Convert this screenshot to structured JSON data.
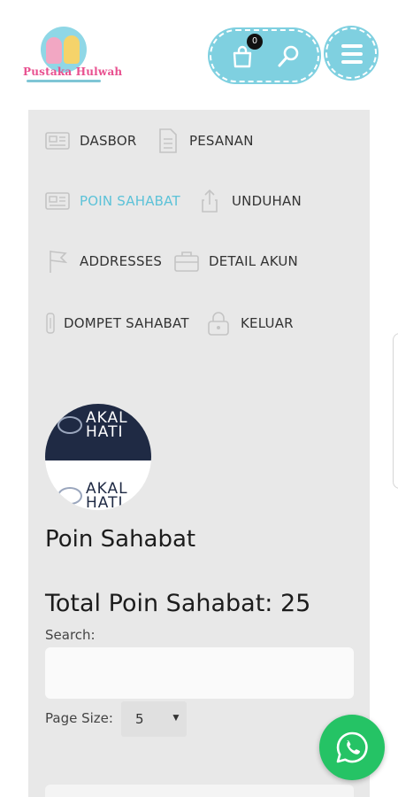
{
  "header": {
    "logo_text": "Pustaka Hulwah",
    "cart_count": "0"
  },
  "nav": [
    {
      "label": "DASBOR",
      "icon": "dashboard-icon",
      "active": false
    },
    {
      "label": "PESANAN",
      "icon": "document-icon",
      "active": false
    },
    {
      "label": "POIN SAHABAT",
      "icon": "points-icon",
      "active": true
    },
    {
      "label": "UNDUHAN",
      "icon": "download-icon",
      "active": false
    },
    {
      "label": "ADDRESSES",
      "icon": "flag-icon",
      "active": false
    },
    {
      "label": "DETAIL AKUN",
      "icon": "briefcase-icon",
      "active": false
    },
    {
      "label": "DOMPET SAHABAT",
      "icon": "wallet-icon",
      "active": false
    },
    {
      "label": "KELUAR",
      "icon": "lock-icon",
      "active": false
    }
  ],
  "avatar": {
    "line1": "AKAL",
    "line2": "HATI"
  },
  "main": {
    "title": "Poin Sahabat",
    "total": "Total Poin Sahabat: 25",
    "search_label": "Search:",
    "search_value": "",
    "page_size_label": "Page Size:",
    "page_size_value": "5"
  },
  "colors": {
    "accent": "#7fd0e0",
    "active_link": "#5cc2d8",
    "panel_bg": "#e8e8e8",
    "whatsapp": "#25c365",
    "logo_pink": "#e8508f"
  }
}
